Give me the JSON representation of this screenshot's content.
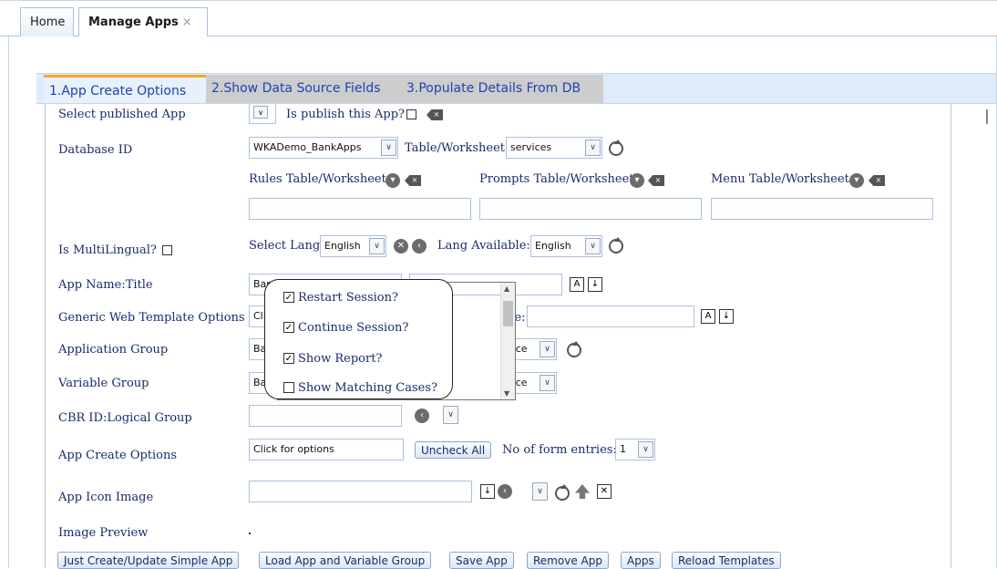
{
  "tabs": {
    "home": "Home",
    "active": "Manage Apps",
    "close": "×"
  },
  "steps": [
    "1.App Create Options",
    "2.Show Data Source Fields",
    "3.Populate Details From DB"
  ],
  "labels": {
    "select_published": "Select published App",
    "is_publish": "Is publish this App?",
    "database_id": "Database ID",
    "table_ws": "Table/Worksheet:",
    "rules_ws": "Rules Table/Worksheet",
    "prompts_ws": "Prompts Table/Worksheet",
    "menu_ws": "Menu Table/Worksheet",
    "multilingual": "Is MultiLingual?",
    "select_lang": "Select Lang:",
    "lang_available": "Lang Available:",
    "app_name": "App Name:Title",
    "generic_web": "Generic Web Template Options",
    "title_suffix": "tle:",
    "app_group": "Application Group",
    "variable_group": "Variable Group",
    "cbr_id": "CBR ID:Logical Group",
    "app_create_options": "App Create Options",
    "no_form_entries": "No of form entries:",
    "app_icon": "App Icon Image",
    "image_preview": "Image Preview"
  },
  "values": {
    "database_id": "WKADemo_BankApps",
    "table_ws": "services",
    "select_lang": "English",
    "lang_available": "English",
    "app_name_partial": "Ban",
    "generic_partial": "Clic",
    "app_group_partial": "Ban",
    "variable_group_partial": "Ban",
    "app_group_suffix": "ace",
    "variable_group_suffix": "ace",
    "app_create_options": "Click for options",
    "no_form_entries": "1"
  },
  "buttons": {
    "uncheck_all": "Uncheck All",
    "just_create": "Just Create/Update Simple App",
    "load_app": "Load App and Variable Group",
    "save_app": "Save App",
    "remove_app": "Remove App",
    "apps": "Apps",
    "reload_templates": "Reload Templates"
  },
  "popup_options": [
    {
      "label": "Restart Session?",
      "checked": true
    },
    {
      "label": "Continue Session?",
      "checked": true
    },
    {
      "label": "Show Report?",
      "checked": true
    },
    {
      "label": "Show Matching Cases?",
      "checked": false
    }
  ],
  "colors": {
    "accent": "#f4a62a",
    "step_bg": "#ddebfb",
    "label": "#1a2a6c"
  }
}
